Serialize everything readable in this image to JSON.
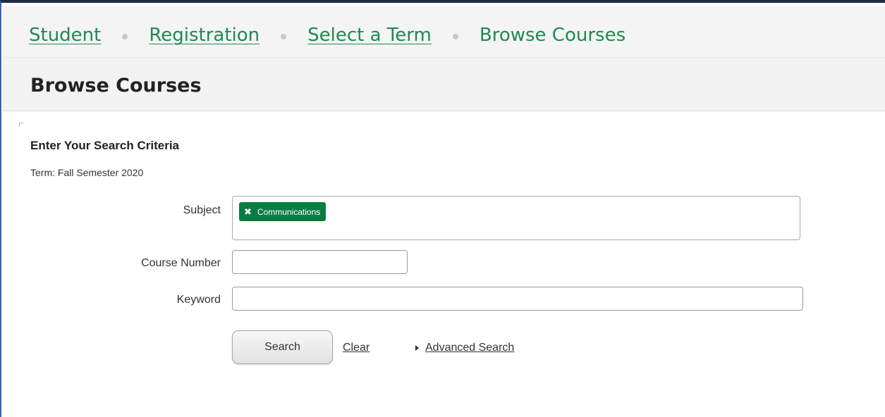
{
  "breadcrumb": {
    "items": [
      {
        "label": "Student"
      },
      {
        "label": "Registration"
      },
      {
        "label": "Select a Term"
      }
    ],
    "current": "Browse Courses"
  },
  "page": {
    "title": "Browse Courses"
  },
  "search_form": {
    "heading": "Enter Your Search Criteria",
    "term_text": "Term: Fall Semester 2020",
    "subject": {
      "label": "Subject",
      "selected": [
        "Communications"
      ],
      "remove_symbol": "✖"
    },
    "course_number": {
      "label": "Course Number",
      "value": ""
    },
    "keyword": {
      "label": "Keyword",
      "value": ""
    },
    "search_button": "Search",
    "clear_link": "Clear",
    "advanced_search_link": "Advanced Search"
  },
  "colors": {
    "brand_green": "#1e8a4f",
    "chip_green": "#0a7d43",
    "window_border": "#3b5fbf"
  }
}
